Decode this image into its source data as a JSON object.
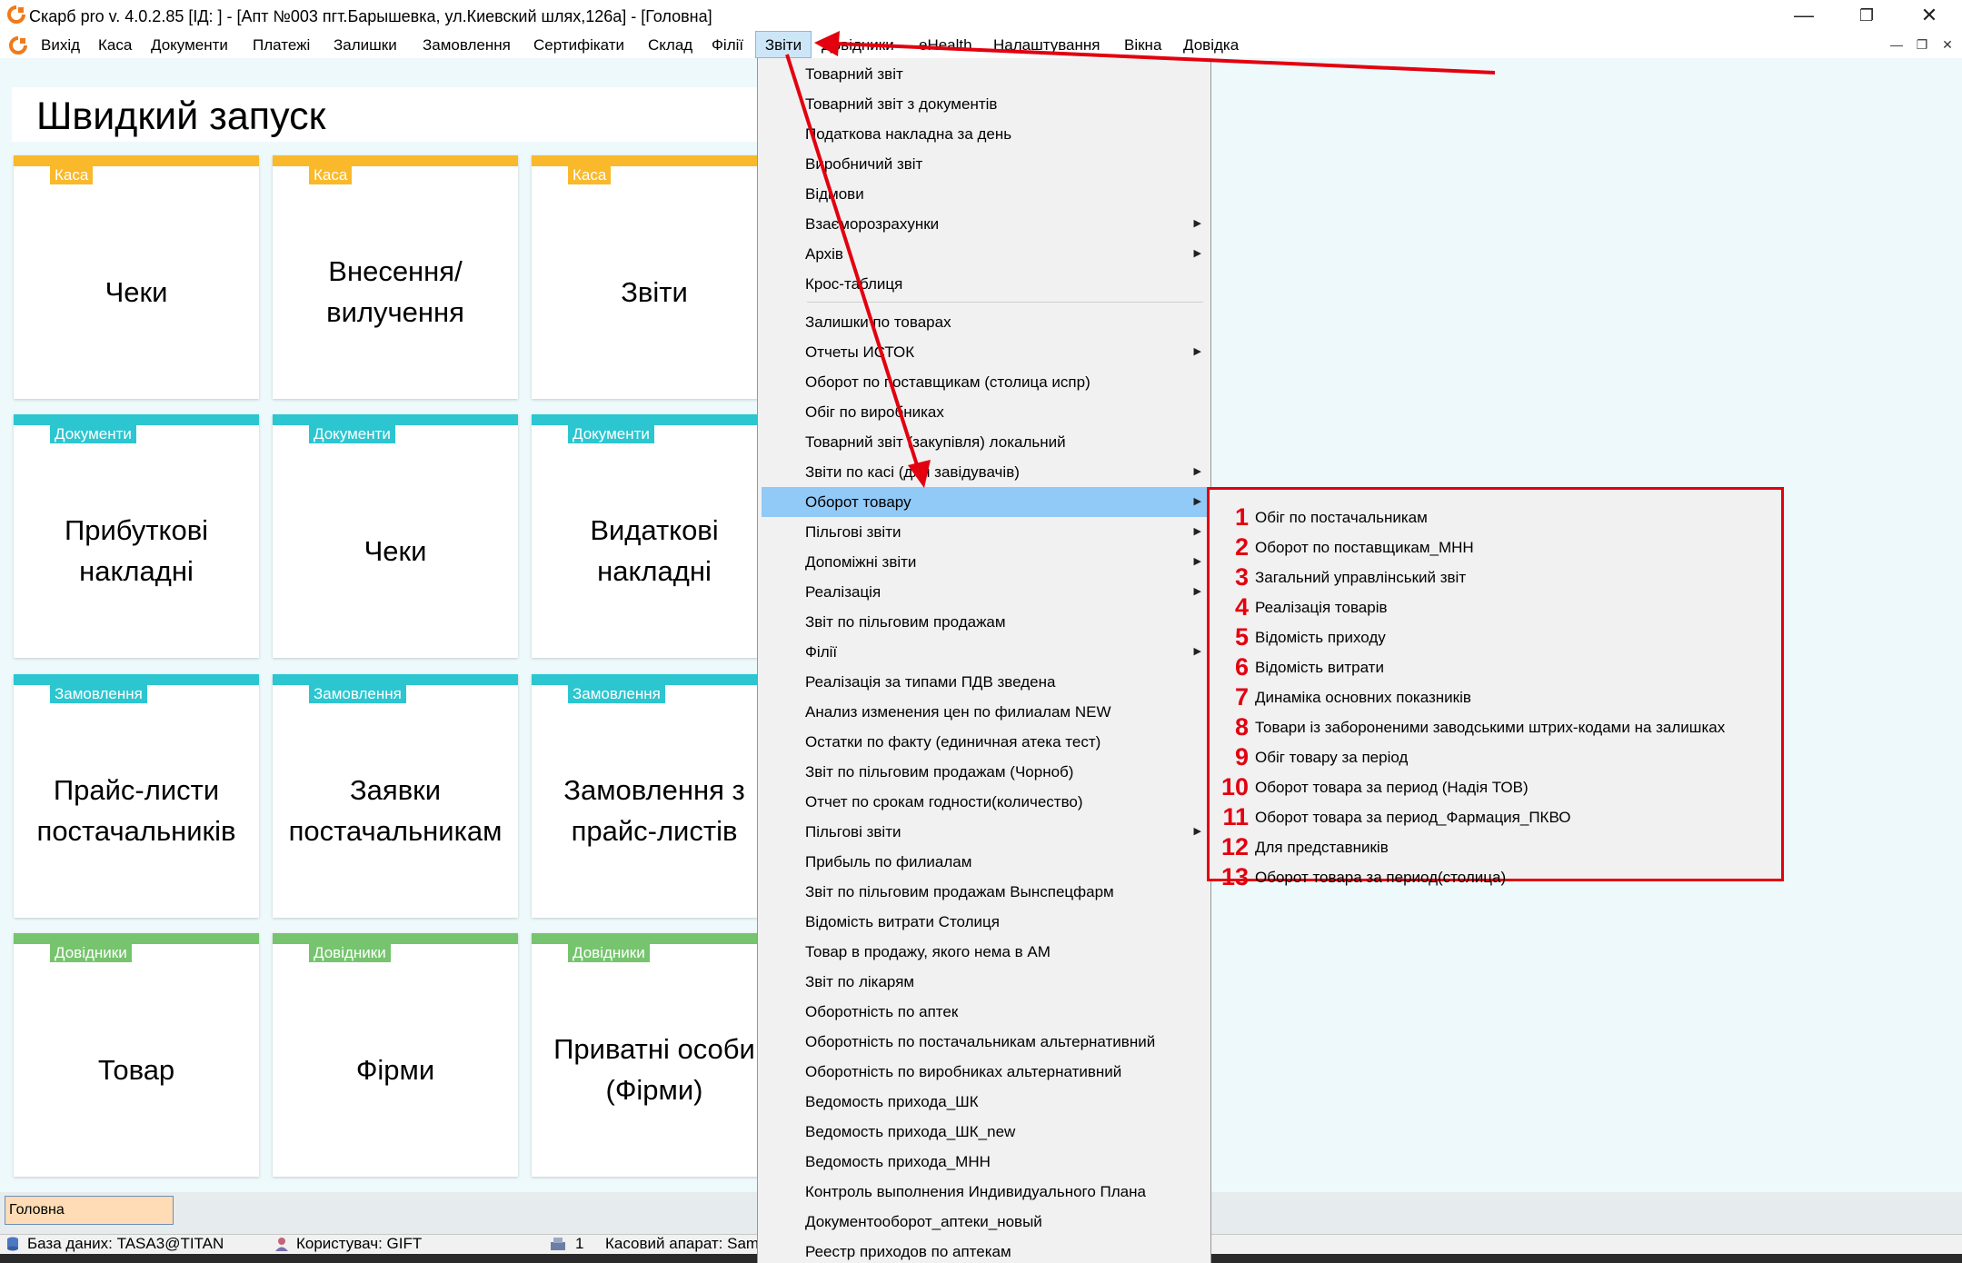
{
  "window": {
    "title": "Скарб pro v. 4.0.2.85 [ІД:         ] - [Апт №003 пгт.Барышевка, ул.Киевский шлях,126а] - [Головна]",
    "controls": {
      "minimize": "—",
      "restore": "❐",
      "close": "✕"
    }
  },
  "menubar": {
    "items": [
      "Вихід",
      "Каса",
      "Документи",
      "Платежі",
      "Залишки",
      "Замовлення",
      "Сертифікати",
      "Склад",
      "Філії",
      "Звіти",
      "Довідники",
      "eHealth",
      "Налаштування",
      "Вікна",
      "Довідка"
    ],
    "mdi_controls": [
      "—",
      "❐",
      "✕"
    ]
  },
  "quick_launch": {
    "title": "Швидкий запуск",
    "tiles": [
      {
        "category": "Каса",
        "label": "Чеки",
        "color": "#f9b92a"
      },
      {
        "category": "Каса",
        "label": "Внесення/вилучення",
        "color": "#f9b92a"
      },
      {
        "category": "Каса",
        "label": "Звіти",
        "color": "#f9b92a"
      },
      {
        "category": "Документи",
        "label": "Прибуткові накладні",
        "color": "#2cc6d0"
      },
      {
        "category": "Документи",
        "label": "Чеки",
        "color": "#2cc6d0"
      },
      {
        "category": "Документи",
        "label": "Видаткові накладні",
        "color": "#2cc6d0"
      },
      {
        "category": "Замовлення",
        "label": "Прайс-листи постачальників",
        "color": "#2cc6d0"
      },
      {
        "category": "Замовлення",
        "label": "Заявки постачальникам",
        "color": "#2cc6d0"
      },
      {
        "category": "Замовлення",
        "label": "Замовлення з прайс-листів",
        "color": "#2cc6d0"
      },
      {
        "category": "Довідники",
        "label": "Товар",
        "color": "#76c46e"
      },
      {
        "category": "Довідники",
        "label": "Фірми",
        "color": "#76c46e"
      },
      {
        "category": "Довідники",
        "label": "Приватні особи (Фірми)",
        "color": "#76c46e"
      }
    ]
  },
  "tab_main": "Головна",
  "statusbar": {
    "database": "База даних: TASA3@TITAN",
    "user": "Користувач: GIFT",
    "count": "1",
    "cash_register": "Касовий апарат: Sam"
  },
  "reports_menu": {
    "items": [
      {
        "label": "Товарний звіт",
        "submenu": false
      },
      {
        "label": "Товарний звіт з документів",
        "submenu": false
      },
      {
        "label": "Податкова накладна за день",
        "submenu": false
      },
      {
        "label": "Виробничий звіт",
        "submenu": false
      },
      {
        "label": "Відмови",
        "submenu": false
      },
      {
        "label": "Взаєморозрахунки",
        "submenu": true
      },
      {
        "label": "Архів",
        "submenu": true
      },
      {
        "label": "Крос-таблиця",
        "submenu": false
      },
      {
        "label": "Залишки по товарах",
        "submenu": false
      },
      {
        "label": "Отчеты ИСТОК",
        "submenu": true
      },
      {
        "label": "Оборот по поставщикам (столица испр)",
        "submenu": false
      },
      {
        "label": "Обіг по виробниках",
        "submenu": false
      },
      {
        "label": "Товарний звіт (закупівля) локальний",
        "submenu": false
      },
      {
        "label": "Звіти по касі (для завідувачів)",
        "submenu": true
      },
      {
        "label": "Оборот товару",
        "submenu": true,
        "highlighted": true
      },
      {
        "label": "Пільгові звіти",
        "submenu": true
      },
      {
        "label": "Допоміжні звіти",
        "submenu": true
      },
      {
        "label": "Реалізація",
        "submenu": true
      },
      {
        "label": "Звіт по пільговим продажам",
        "submenu": false
      },
      {
        "label": "Філії",
        "submenu": true
      },
      {
        "label": "Реалізація за типами ПДВ зведена",
        "submenu": false
      },
      {
        "label": "Анализ изменения цен по филиалам NEW",
        "submenu": false
      },
      {
        "label": "Остатки по факту (единичная атека тест)",
        "submenu": false
      },
      {
        "label": "Звіт по пільговим продажам (Чорноб)",
        "submenu": false
      },
      {
        "label": "Отчет по срокам годности(количество)",
        "submenu": false
      },
      {
        "label": "Пільгові звіти",
        "submenu": true
      },
      {
        "label": "Прибыль по филиалам",
        "submenu": false
      },
      {
        "label": "Звіт по пільговим продажам Вынспецфарм",
        "submenu": false
      },
      {
        "label": "Відомість витрати Столиця",
        "submenu": false
      },
      {
        "label": "Товар в продажу, якого нема в АМ",
        "submenu": false
      },
      {
        "label": "Звіт по лікарям",
        "submenu": false
      },
      {
        "label": "Оборотність по аптек",
        "submenu": false
      },
      {
        "label": "Оборотність по постачальникам альтернативний",
        "submenu": false
      },
      {
        "label": "Оборотність по виробниках альтернативний",
        "submenu": false
      },
      {
        "label": "Ведомость прихода_ШК",
        "submenu": false
      },
      {
        "label": "Ведомость прихода_ШК_new",
        "submenu": false
      },
      {
        "label": "Ведомость прихода_МНН",
        "submenu": false
      },
      {
        "label": "Контроль выполнения Индивидуального Плана",
        "submenu": false
      },
      {
        "label": "Документооборот_аптеки_новый",
        "submenu": false
      },
      {
        "label": "Реестр приходов по аптекам",
        "submenu": false
      }
    ]
  },
  "turnover_submenu": {
    "items": [
      {
        "num": "1",
        "label": "Обіг по постачальникам"
      },
      {
        "num": "2",
        "label": "Оборот по поставщикам_МНН"
      },
      {
        "num": "3",
        "label": "Загальний управлінський звіт"
      },
      {
        "num": "4",
        "label": "Реалізація товарів"
      },
      {
        "num": "5",
        "label": "Відомість приходу"
      },
      {
        "num": "6",
        "label": "Відомість витрати"
      },
      {
        "num": "7",
        "label": "Динаміка основних показників"
      },
      {
        "num": "8",
        "label": "Товари із забороненими заводськими штрих-кодами на залишках"
      },
      {
        "num": "9",
        "label": "Обіг товару за період"
      },
      {
        "num": "10",
        "label": "Оборот товара за период (Надія ТОВ)"
      },
      {
        "num": "11",
        "label": "Оборот товара за период_Фармация_ПКВО"
      },
      {
        "num": "12",
        "label": "Для представників"
      },
      {
        "num": "13",
        "label": "Оборот товара за период(столица)"
      }
    ]
  },
  "colors": {
    "annotation": "#e3000f",
    "highlight": "#91c9f7",
    "app_icon": "#f07a1a"
  }
}
